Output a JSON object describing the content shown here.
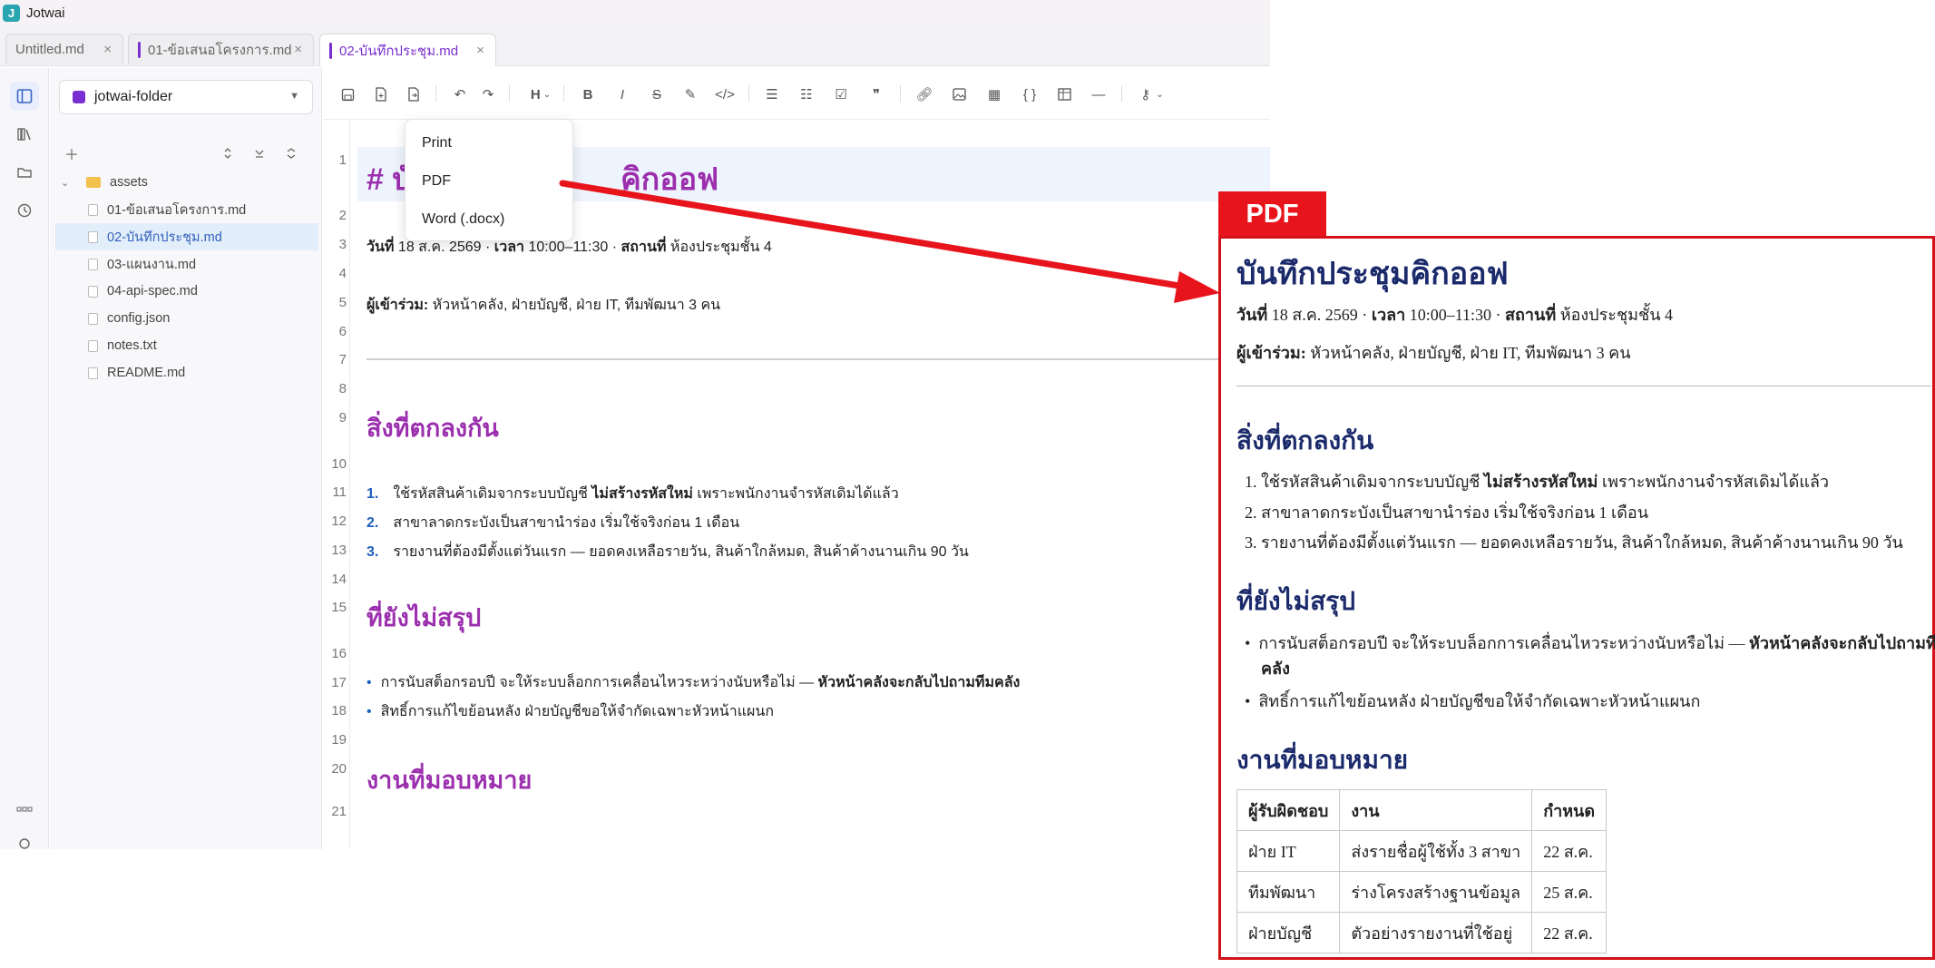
{
  "window": {
    "title": "Jotwai",
    "logo_letter": "J"
  },
  "tabs": [
    {
      "label": "Untitled.md",
      "close": "×"
    },
    {
      "label": "01-ข้อเสนอโครงการ.md",
      "close": "×"
    },
    {
      "label": "02-บันทึกประชุม.md",
      "close": "×"
    }
  ],
  "sidebar": {
    "folder": "jotwai-folder",
    "tree": [
      {
        "label": "assets",
        "type": "folder"
      },
      {
        "label": "01-ข้อเสนอโครงการ.md",
        "type": "file"
      },
      {
        "label": "02-บันทึกประชุม.md",
        "type": "file",
        "selected": true
      },
      {
        "label": "03-แผนงาน.md",
        "type": "file"
      },
      {
        "label": "04-api-spec.md",
        "type": "file"
      },
      {
        "label": "config.json",
        "type": "file"
      },
      {
        "label": "notes.txt",
        "type": "file"
      },
      {
        "label": "README.md",
        "type": "file"
      }
    ]
  },
  "export_menu": {
    "items": [
      "Print",
      "PDF",
      "Word (.docx)"
    ]
  },
  "editor": {
    "line_numbers": [
      "1",
      "2",
      "3",
      "4",
      "5",
      "6",
      "7",
      "8",
      "9",
      "10",
      "11",
      "12",
      "13",
      "14",
      "15",
      "16",
      "17",
      "18",
      "19",
      "20",
      "21"
    ],
    "h1_prefix": "# บั",
    "h1_tail": "คิกออฟ",
    "meta": {
      "date_label": "วันที่",
      "date_visible": "18 ส.ค. 2569 ·",
      "time_label": "เวลา",
      "time_value": "10:00–11:30 ·",
      "place_label": "สถานที่",
      "place_value": "ห้องประชุมชั้น 4"
    },
    "attendees_label": "ผู้เข้าร่วม:",
    "attendees_value": "หัวหน้าคลัง, ฝ่ายบัญชี, ฝ่าย IT, ทีมพัฒนา 3 คน",
    "h2_agreed": "สิ่งที่ตกลงกัน",
    "agreed": [
      {
        "num": "1.",
        "pre": "ใช้รหัสสินค้าเดิมจากระบบบัญชี ",
        "bold": "ไม่สร้างรหัสใหม่",
        "post": " เพราะพนักงานจำรหัสเดิมได้แล้ว"
      },
      {
        "num": "2.",
        "pre": "สาขาลาดกระบังเป็นสาขานำร่อง เริ่มใช้จริงก่อน 1 เดือน",
        "bold": "",
        "post": ""
      },
      {
        "num": "3.",
        "pre": "รายงานที่ต้องมีตั้งแต่วันแรก — ยอดคงเหลือรายวัน, สินค้าใกล้หมด, สินค้าค้างนานเกิน 90 วัน",
        "bold": "",
        "post": ""
      }
    ],
    "h2_pending": "ที่ยังไม่สรุป",
    "pending": [
      {
        "bullet": "•",
        "pre": "การนับสต็อกรอบปี จะให้ระบบล็อกการเคลื่อนไหวระหว่างนับหรือไม่ — ",
        "bold": "หัวหน้าคลังจะกลับไปถามทีมคลัง"
      },
      {
        "bullet": "•",
        "pre": "สิทธิ์การแก้ไขย้อนหลัง ฝ่ายบัญชีขอให้จำกัดเฉพาะหัวหน้าแผนก",
        "bold": ""
      }
    ],
    "h2_assign": "งานที่มอบหมาย"
  },
  "pdf_preview": {
    "badge": "PDF",
    "title": "บันทึกประชุมคิกออฟ",
    "meta": {
      "date_label": "วันที่",
      "date_value": "18 ส.ค. 2569 ·",
      "time_label": "เวลา",
      "time_value": "10:00–11:30 ·",
      "place_label": "สถานที่",
      "place_value": "ห้องประชุมชั้น 4"
    },
    "attendees_label": "ผู้เข้าร่วม:",
    "attendees_value": "หัวหน้าคลัง, ฝ่ายบัญชี, ฝ่าย IT, ทีมพัฒนา 3 คน",
    "h2_agreed": "สิ่งที่ตกลงกัน",
    "agreed": [
      {
        "num": "1.",
        "pre": "ใช้รหัสสินค้าเดิมจากระบบบัญชี ",
        "bold": "ไม่สร้างรหัสใหม่",
        "post": " เพราะพนักงานจำรหัสเดิมได้แล้ว"
      },
      {
        "num": "2.",
        "pre": "สาขาลาดกระบังเป็นสาขานำร่อง เริ่มใช้จริงก่อน 1 เดือน",
        "bold": "",
        "post": ""
      },
      {
        "num": "3.",
        "pre": "รายงานที่ต้องมีตั้งแต่วันแรก — ยอดคงเหลือรายวัน, สินค้าใกล้หมด, สินค้าค้างนานเกิน 90 วัน",
        "bold": "",
        "post": ""
      }
    ],
    "h2_pending": "ที่ยังไม่สรุป",
    "pending": [
      {
        "pre": "การนับสต็อกรอบปี จะให้ระบบล็อกการเคลื่อนไหวระหว่างนับหรือไม่ — ",
        "bold": "หัวหน้าคลังจะกลับไปถามทีม",
        "bold_wrap": "คลัง"
      },
      {
        "pre": "สิทธิ์การแก้ไขย้อนหลัง ฝ่ายบัญชีขอให้จำกัดเฉพาะหัวหน้าแผนก",
        "bold": "",
        "bold_wrap": ""
      }
    ],
    "h2_assign": "งานที่มอบหมาย",
    "table": {
      "headers": [
        "ผู้รับผิดชอบ",
        "งาน",
        "กำหนด"
      ],
      "rows": [
        [
          "ฝ่าย IT",
          "ส่งรายชื่อผู้ใช้ทั้ง 3 สาขา",
          "22 ส.ค."
        ],
        [
          "ทีมพัฒนา",
          "ร่างโครงสร้างฐานข้อมูล",
          "25 ส.ค."
        ],
        [
          "ฝ่ายบัญชี",
          "ตัวอย่างรายงานที่ใช้อยู่",
          "22 ส.ค."
        ]
      ]
    }
  },
  "colors": {
    "accent_purple": "#7a2fd0",
    "heading_magenta": "#9b2fae",
    "pdf_heading_navy": "#1b2a6b",
    "annotation_red": "#e8141c",
    "list_blue": "#1f5fbf"
  },
  "icons": {
    "activity": [
      "sidebar-toggle-icon",
      "library-icon",
      "folder-open-icon",
      "history-icon",
      "more-icon",
      "settings-icon"
    ],
    "toolbar": [
      "save-icon",
      "new-file-icon",
      "export-icon",
      "undo-icon",
      "redo-icon",
      "heading-icon",
      "bold-icon",
      "italic-icon",
      "strikethrough-icon",
      "highlight-icon",
      "code-icon",
      "bullet-list-icon",
      "numbered-list-icon",
      "task-list-icon",
      "quote-icon",
      "link-icon",
      "image-icon",
      "qr-icon",
      "code-block-icon",
      "table-icon",
      "horizontal-rule-icon",
      "tools-icon"
    ]
  }
}
